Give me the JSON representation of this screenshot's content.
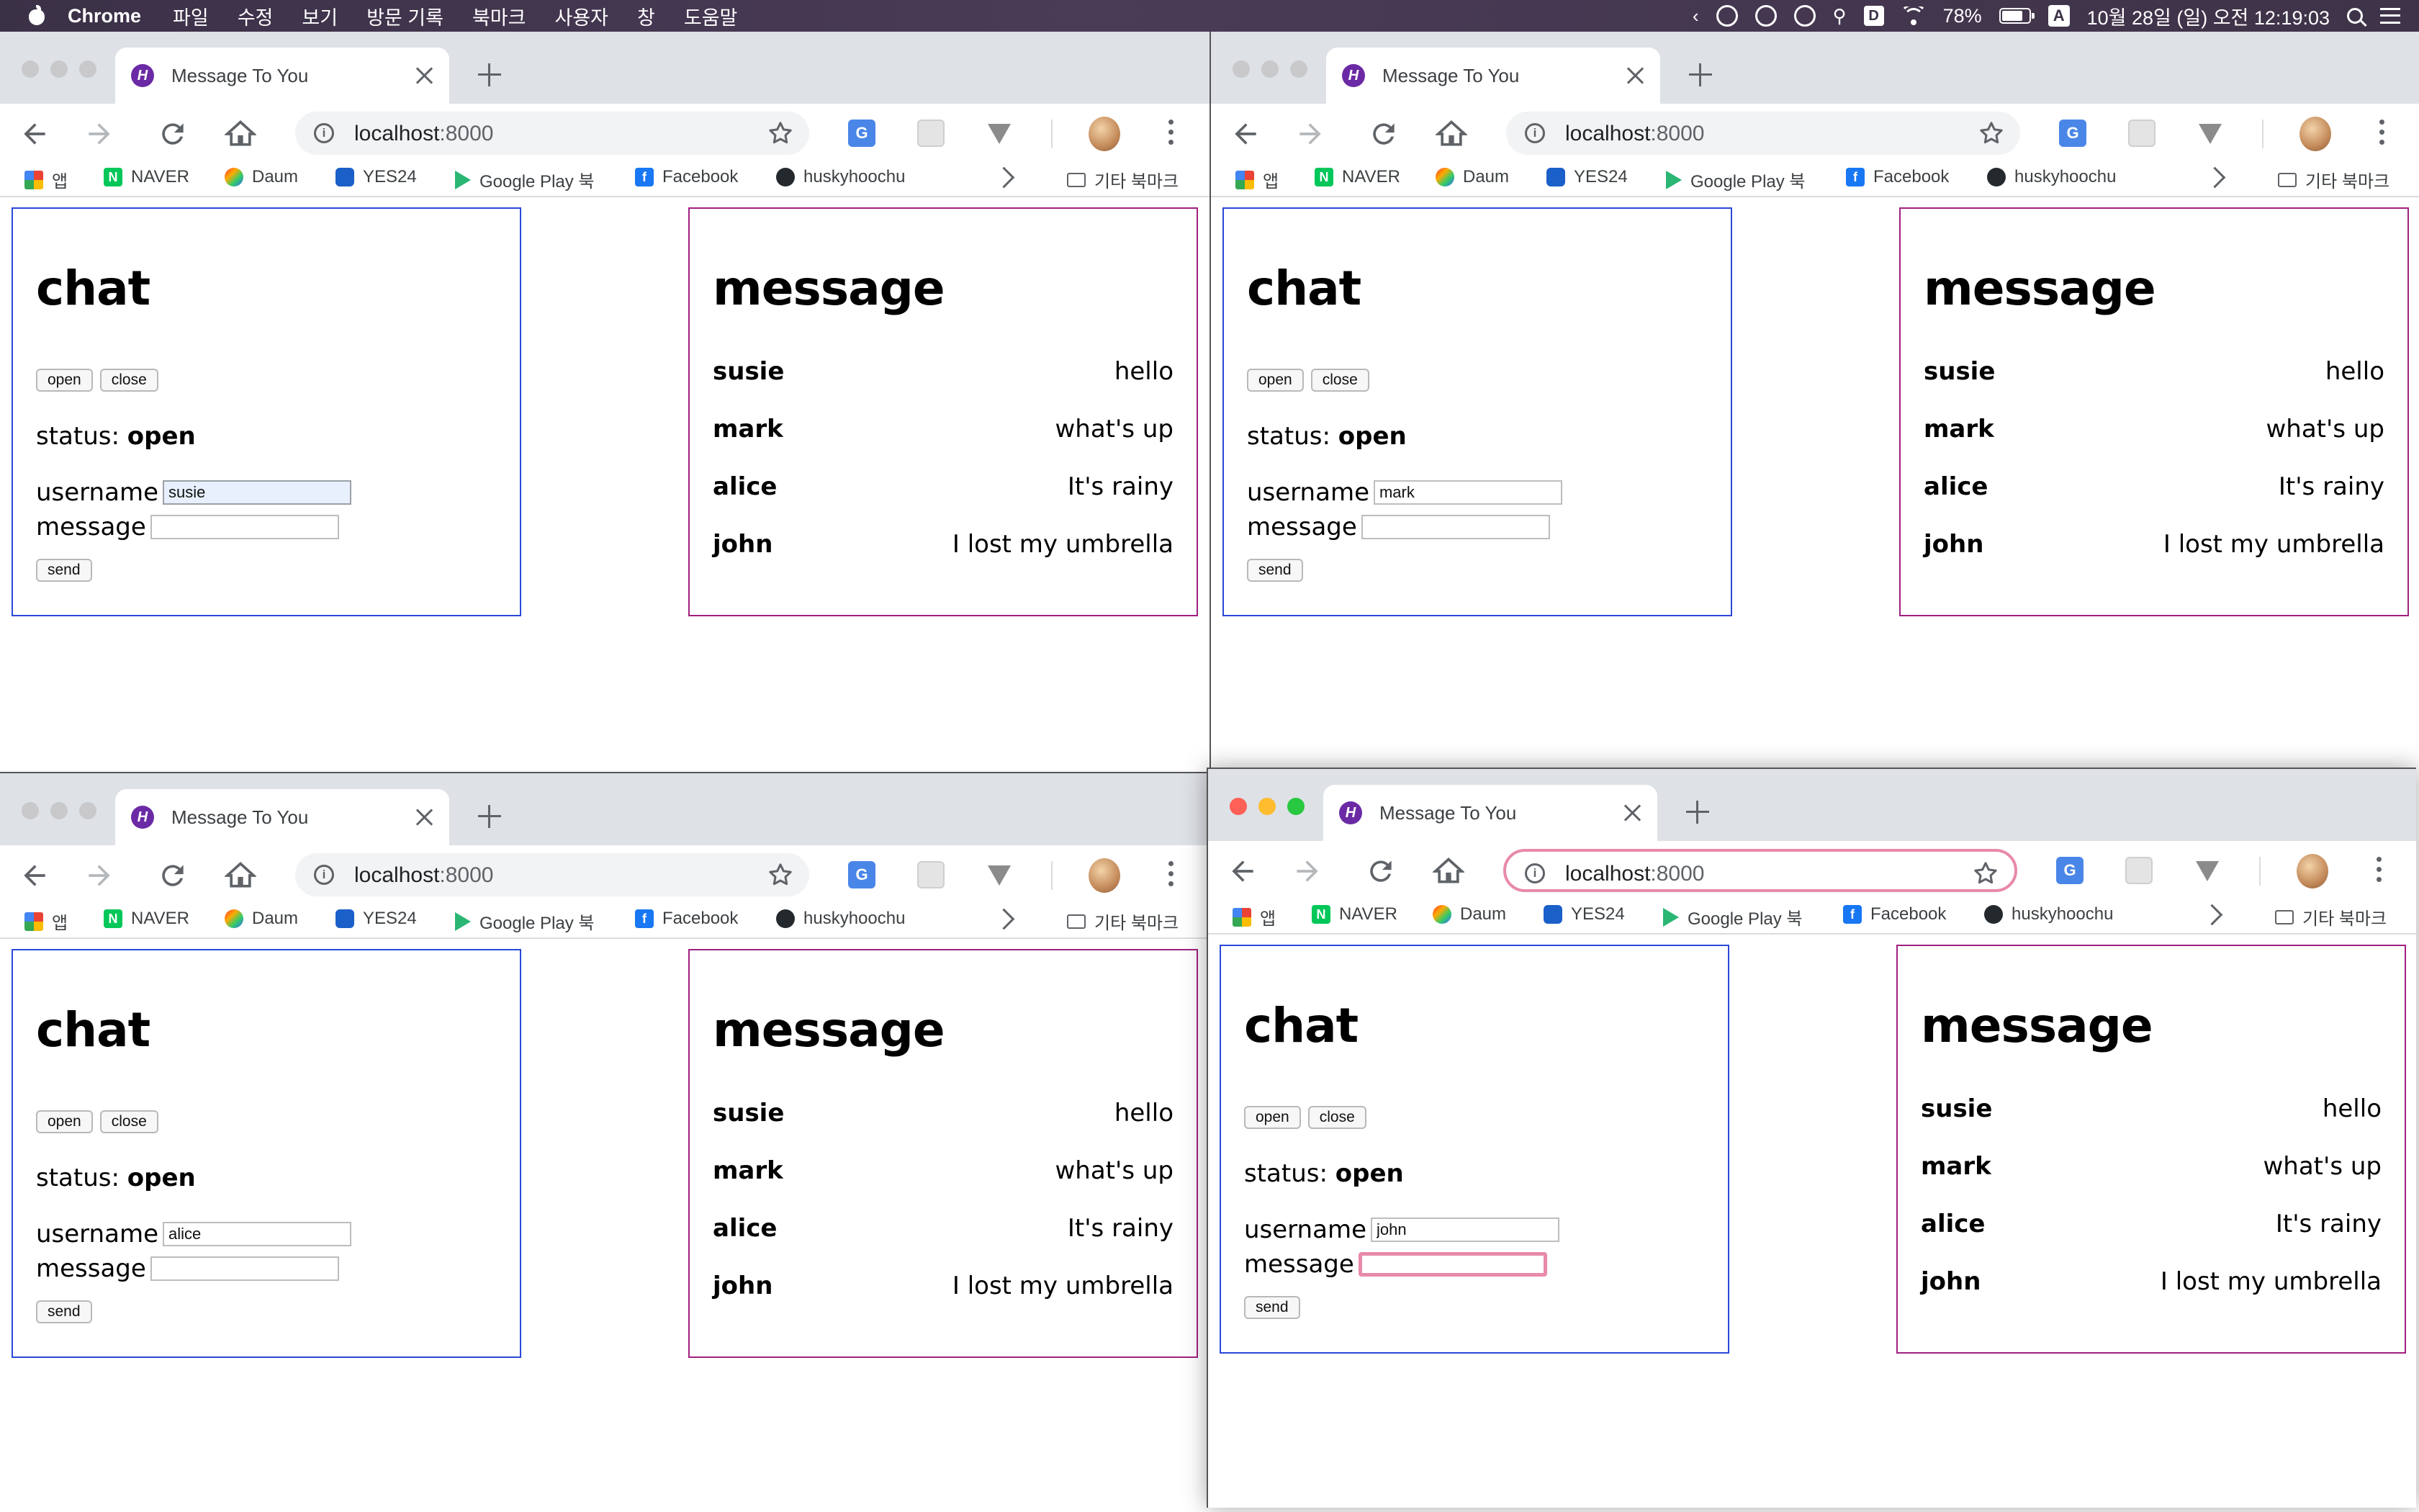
{
  "menubar": {
    "app": "Chrome",
    "menus": [
      "파일",
      "수정",
      "보기",
      "방문 기록",
      "북마크",
      "사용자",
      "창",
      "도움말"
    ],
    "battery": "78%",
    "input_source": "A",
    "datetime": "10월 28일 (일) 오전 12:19:03"
  },
  "browser": {
    "tab_title": "Message To You",
    "url_host": "localhost",
    "url_port": ":8000",
    "bookmarks": [
      "앱",
      "NAVER",
      "Daum",
      "YES24",
      "Google Play 북",
      "Facebook",
      "huskyhoochu"
    ],
    "other_bookmarks": "기타 북마크"
  },
  "chat": {
    "title": "chat",
    "open_label": "open",
    "close_label": "close",
    "status_label": "status:",
    "status_value": "open",
    "username_label": "username",
    "message_label": "message",
    "send_label": "send"
  },
  "message_panel": {
    "title": "message",
    "messages": [
      {
        "user": "susie",
        "text": "hello"
      },
      {
        "user": "mark",
        "text": "what's up"
      },
      {
        "user": "alice",
        "text": "It's rainy"
      },
      {
        "user": "john",
        "text": "I lost my umbrella"
      }
    ]
  },
  "windows": [
    {
      "username_value": "susie",
      "message_value": "",
      "active": false
    },
    {
      "username_value": "mark",
      "message_value": "",
      "active": false
    },
    {
      "username_value": "alice",
      "message_value": "",
      "active": false
    },
    {
      "username_value": "john",
      "message_value": "",
      "active": true
    }
  ],
  "colors": {
    "chat_border": "#2a48d8",
    "message_border": "#a02080",
    "focus_ring": "#e88aa8",
    "menubar": "#3b3147"
  }
}
